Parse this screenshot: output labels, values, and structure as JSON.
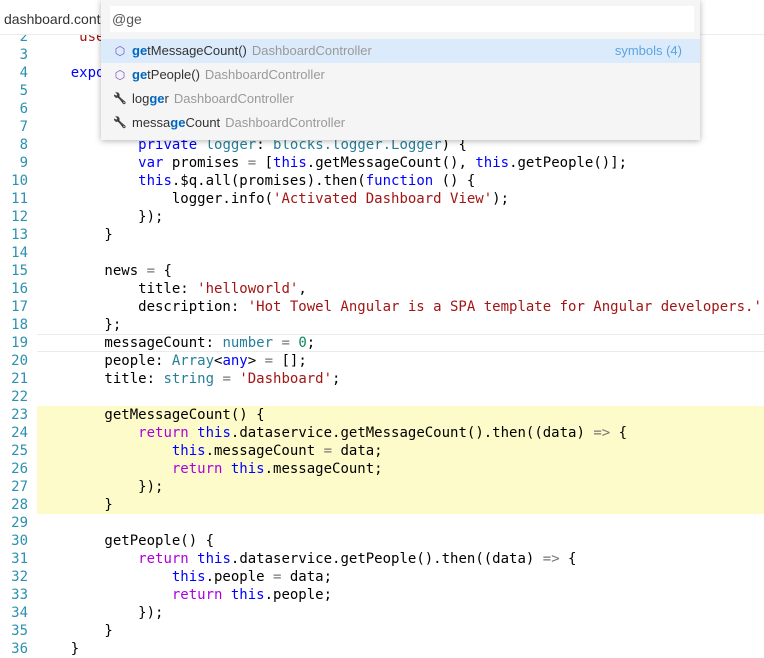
{
  "tab": {
    "title": "dashboard.controller.ts"
  },
  "quick_open": {
    "query": "@ge",
    "items": [
      {
        "icon": "method-icon",
        "pre": "",
        "match": "ge",
        "post": "tMessageCount()",
        "container": "DashboardController",
        "meta": "symbols (4)",
        "selected": true
      },
      {
        "icon": "method-icon",
        "pre": "",
        "match": "ge",
        "post": "tPeople()",
        "container": "DashboardController",
        "meta": "",
        "selected": false
      },
      {
        "icon": "wrench-icon",
        "pre": "log",
        "match": "ge",
        "post": "r",
        "container": "DashboardController",
        "meta": "",
        "selected": false
      },
      {
        "icon": "wrench-icon",
        "pre": "messa",
        "match": "ge",
        "post": "Count",
        "container": "DashboardController",
        "meta": "",
        "selected": false
      }
    ]
  },
  "editor": {
    "highlight_lines": [
      23,
      24,
      25,
      26,
      27,
      28
    ],
    "current_line": 19,
    "colors": {
      "keyword": "#0000ff",
      "control": "#af00db",
      "type": "#267f99",
      "string": "#a31515",
      "number": "#09885a",
      "line_number": "#2b91af",
      "highlight": "#fdfbc9"
    },
    "lines": [
      {
        "n": "2",
        "tokens": [
          [
            "p",
            "    "
          ],
          [
            "s",
            "'use"
          ]
        ]
      },
      {
        "n": "3",
        "tokens": []
      },
      {
        "n": "4",
        "tokens": [
          [
            "p",
            "    "
          ],
          [
            "k",
            "expo"
          ]
        ]
      },
      {
        "n": "5",
        "tokens": []
      },
      {
        "n": "6",
        "tokens": []
      },
      {
        "n": "7",
        "tokens": []
      },
      {
        "n": "8",
        "tokens": [
          [
            "p",
            "            "
          ],
          [
            "k",
            "private"
          ],
          [
            "p",
            " "
          ],
          [
            "t",
            "logger"
          ],
          [
            "p",
            ": "
          ],
          [
            "t",
            "blocks.logger.Logger"
          ],
          [
            "p",
            ") {"
          ]
        ]
      },
      {
        "n": "9",
        "tokens": [
          [
            "p",
            "            "
          ],
          [
            "k",
            "var"
          ],
          [
            "p",
            " promises "
          ],
          [
            "o",
            "="
          ],
          [
            "p",
            " ["
          ],
          [
            "k",
            "this"
          ],
          [
            "p",
            ".getMessageCount(), "
          ],
          [
            "k",
            "this"
          ],
          [
            "p",
            ".getPeople()];"
          ]
        ]
      },
      {
        "n": "10",
        "tokens": [
          [
            "p",
            "            "
          ],
          [
            "k",
            "this"
          ],
          [
            "p",
            ".$q.all(promises).then("
          ],
          [
            "k",
            "function"
          ],
          [
            "p",
            " () {"
          ]
        ]
      },
      {
        "n": "11",
        "tokens": [
          [
            "p",
            "                logger.info("
          ],
          [
            "s",
            "'Activated Dashboard View'"
          ],
          [
            "p",
            ");"
          ]
        ]
      },
      {
        "n": "12",
        "tokens": [
          [
            "p",
            "            });"
          ]
        ]
      },
      {
        "n": "13",
        "tokens": [
          [
            "p",
            "        }"
          ]
        ]
      },
      {
        "n": "14",
        "tokens": []
      },
      {
        "n": "15",
        "tokens": [
          [
            "p",
            "        news "
          ],
          [
            "o",
            "="
          ],
          [
            "p",
            " {"
          ]
        ]
      },
      {
        "n": "16",
        "tokens": [
          [
            "p",
            "            title: "
          ],
          [
            "s",
            "'helloworld'"
          ],
          [
            "p",
            ","
          ]
        ]
      },
      {
        "n": "17",
        "tokens": [
          [
            "p",
            "            description: "
          ],
          [
            "s",
            "'Hot Towel Angular is a SPA template for Angular developers.'"
          ]
        ]
      },
      {
        "n": "18",
        "tokens": [
          [
            "p",
            "        };"
          ]
        ]
      },
      {
        "n": "19",
        "tokens": [
          [
            "p",
            "        messageCount: "
          ],
          [
            "t",
            "number"
          ],
          [
            "p",
            " "
          ],
          [
            "o",
            "="
          ],
          [
            "p",
            " "
          ],
          [
            "n",
            "0"
          ],
          [
            "p",
            ";"
          ]
        ]
      },
      {
        "n": "20",
        "tokens": [
          [
            "p",
            "        people: "
          ],
          [
            "t",
            "Array"
          ],
          [
            "p",
            "<"
          ],
          [
            "k",
            "any"
          ],
          [
            "p",
            "> "
          ],
          [
            "o",
            "="
          ],
          [
            "p",
            " [];"
          ]
        ]
      },
      {
        "n": "21",
        "tokens": [
          [
            "p",
            "        title: "
          ],
          [
            "t",
            "string"
          ],
          [
            "p",
            " "
          ],
          [
            "o",
            "="
          ],
          [
            "p",
            " "
          ],
          [
            "s",
            "'Dashboard'"
          ],
          [
            "p",
            ";"
          ]
        ]
      },
      {
        "n": "22",
        "tokens": []
      },
      {
        "n": "23",
        "tokens": [
          [
            "p",
            "        getMessageCount() {"
          ]
        ]
      },
      {
        "n": "24",
        "tokens": [
          [
            "p",
            "            "
          ],
          [
            "r",
            "return"
          ],
          [
            "p",
            " "
          ],
          [
            "k",
            "this"
          ],
          [
            "p",
            ".dataservice.getMessageCount().then((data) "
          ],
          [
            "o",
            "=>"
          ],
          [
            "p",
            " {"
          ]
        ]
      },
      {
        "n": "25",
        "tokens": [
          [
            "p",
            "                "
          ],
          [
            "k",
            "this"
          ],
          [
            "p",
            ".messageCount "
          ],
          [
            "o",
            "="
          ],
          [
            "p",
            " data;"
          ]
        ]
      },
      {
        "n": "26",
        "tokens": [
          [
            "p",
            "                "
          ],
          [
            "r",
            "return"
          ],
          [
            "p",
            " "
          ],
          [
            "k",
            "this"
          ],
          [
            "p",
            ".messageCount;"
          ]
        ]
      },
      {
        "n": "27",
        "tokens": [
          [
            "p",
            "            });"
          ]
        ]
      },
      {
        "n": "28",
        "tokens": [
          [
            "p",
            "        }"
          ]
        ]
      },
      {
        "n": "29",
        "tokens": []
      },
      {
        "n": "30",
        "tokens": [
          [
            "p",
            "        getPeople() {"
          ]
        ]
      },
      {
        "n": "31",
        "tokens": [
          [
            "p",
            "            "
          ],
          [
            "r",
            "return"
          ],
          [
            "p",
            " "
          ],
          [
            "k",
            "this"
          ],
          [
            "p",
            ".dataservice.getPeople().then((data) "
          ],
          [
            "o",
            "=>"
          ],
          [
            "p",
            " {"
          ]
        ]
      },
      {
        "n": "32",
        "tokens": [
          [
            "p",
            "                "
          ],
          [
            "k",
            "this"
          ],
          [
            "p",
            ".people "
          ],
          [
            "o",
            "="
          ],
          [
            "p",
            " data;"
          ]
        ]
      },
      {
        "n": "33",
        "tokens": [
          [
            "p",
            "                "
          ],
          [
            "r",
            "return"
          ],
          [
            "p",
            " "
          ],
          [
            "k",
            "this"
          ],
          [
            "p",
            ".people;"
          ]
        ]
      },
      {
        "n": "34",
        "tokens": [
          [
            "p",
            "            });"
          ]
        ]
      },
      {
        "n": "35",
        "tokens": [
          [
            "p",
            "        }"
          ]
        ]
      },
      {
        "n": "36",
        "tokens": [
          [
            "p",
            "    }"
          ]
        ]
      }
    ]
  }
}
